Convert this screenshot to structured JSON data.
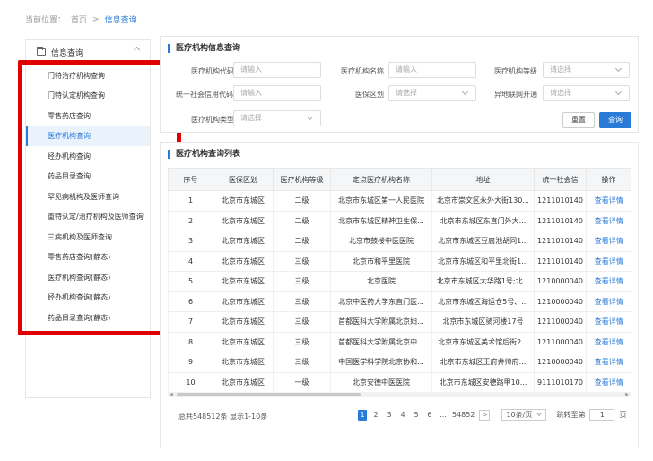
{
  "breadcrumb": {
    "prefix": "当前位置：",
    "home": "首页",
    "sep": ">",
    "current": "信息查询"
  },
  "sidebar": {
    "title": "信息查询",
    "items": [
      "门特治疗机构查询",
      "门特认定机构查询",
      "零售药店查询",
      "医疗机构查询",
      "经办机构查询",
      "药品目录查询",
      "罕见病机构及医师查询",
      "重特认定/治疗机构及医师查询",
      "三病机构及医师查询",
      "零售药店查询(静态)",
      "医疗机构查询(静态)",
      "经办机构查询(静态)",
      "药品目录查询(静态)"
    ],
    "active_index": 3
  },
  "search": {
    "title": "医疗机构信息查询",
    "fields": {
      "code": {
        "label": "医疗机构代码",
        "placeholder": "请输入"
      },
      "name": {
        "label": "医疗机构名称",
        "placeholder": "请输入"
      },
      "level": {
        "label": "医疗机构等级",
        "placeholder": "请选择"
      },
      "credit": {
        "label": "统一社会信用代码",
        "placeholder": "请输入"
      },
      "region": {
        "label": "医保区划",
        "placeholder": "请选择"
      },
      "remote": {
        "label": "异地联网开通",
        "placeholder": "请选择"
      },
      "type": {
        "label": "医疗机构类型",
        "placeholder": "请选择"
      }
    },
    "reset_label": "重置",
    "query_label": "查询"
  },
  "list": {
    "title": "医疗机构查询列表",
    "columns": [
      "序号",
      "医保区划",
      "医疗机构等级",
      "定点医疗机构名称",
      "地址",
      "统一社会信",
      "操作"
    ],
    "rows": [
      [
        "1",
        "北京市东城区",
        "二级",
        "北京市东城区第一人民医院",
        "北京市崇文区永外大街130...",
        "1211010140",
        "查看详情"
      ],
      [
        "2",
        "北京市东城区",
        "二级",
        "北京市东城区精神卫生保...",
        "北京市东城区东直门外大...",
        "1211010140",
        "查看详情"
      ],
      [
        "3",
        "北京市东城区",
        "二级",
        "北京市鼓楼中医医院",
        "北京市东城区豆腐池胡同1...",
        "1211010140",
        "查看详情"
      ],
      [
        "4",
        "北京市东城区",
        "三级",
        "北京市和平里医院",
        "北京市东城区和平里北街1...",
        "1211010140",
        "查看详情"
      ],
      [
        "5",
        "北京市东城区",
        "三级",
        "北京医院",
        "北京市东城区大华路1号;北...",
        "1210000040",
        "查看详情"
      ],
      [
        "6",
        "北京市东城区",
        "三级",
        "北京中医药大学东直门医...",
        "北京市东城区海运仓5号、...",
        "1210000040",
        "查看详情"
      ],
      [
        "7",
        "北京市东城区",
        "三级",
        "首都医科大学附属北京妇...",
        "北京市东城区骑河楼17号",
        "1211000040",
        "查看详情"
      ],
      [
        "8",
        "北京市东城区",
        "三级",
        "首都医科大学附属北京中...",
        "北京市东城区美术馆后街2...",
        "1211000040",
        "查看详情"
      ],
      [
        "9",
        "北京市东城区",
        "三级",
        "中国医学科学院北京协和...",
        "北京市东城区王府井帅府...",
        "1210000040",
        "查看详情"
      ],
      [
        "10",
        "北京市东城区",
        "一级",
        "北京安德中医医院",
        "北京市东城区安德路甲10...",
        "9111010170",
        "查看详情"
      ]
    ]
  },
  "pagination": {
    "summary": "总共548512条 显示1-10条",
    "pages": [
      "1",
      "2",
      "3",
      "4",
      "5",
      "6"
    ],
    "ellipsis": "...",
    "last_page": "54852",
    "next": ">",
    "page_size": "10条/页",
    "goto_label": "跳转至第",
    "goto_value": "1",
    "goto_suffix": "页"
  }
}
